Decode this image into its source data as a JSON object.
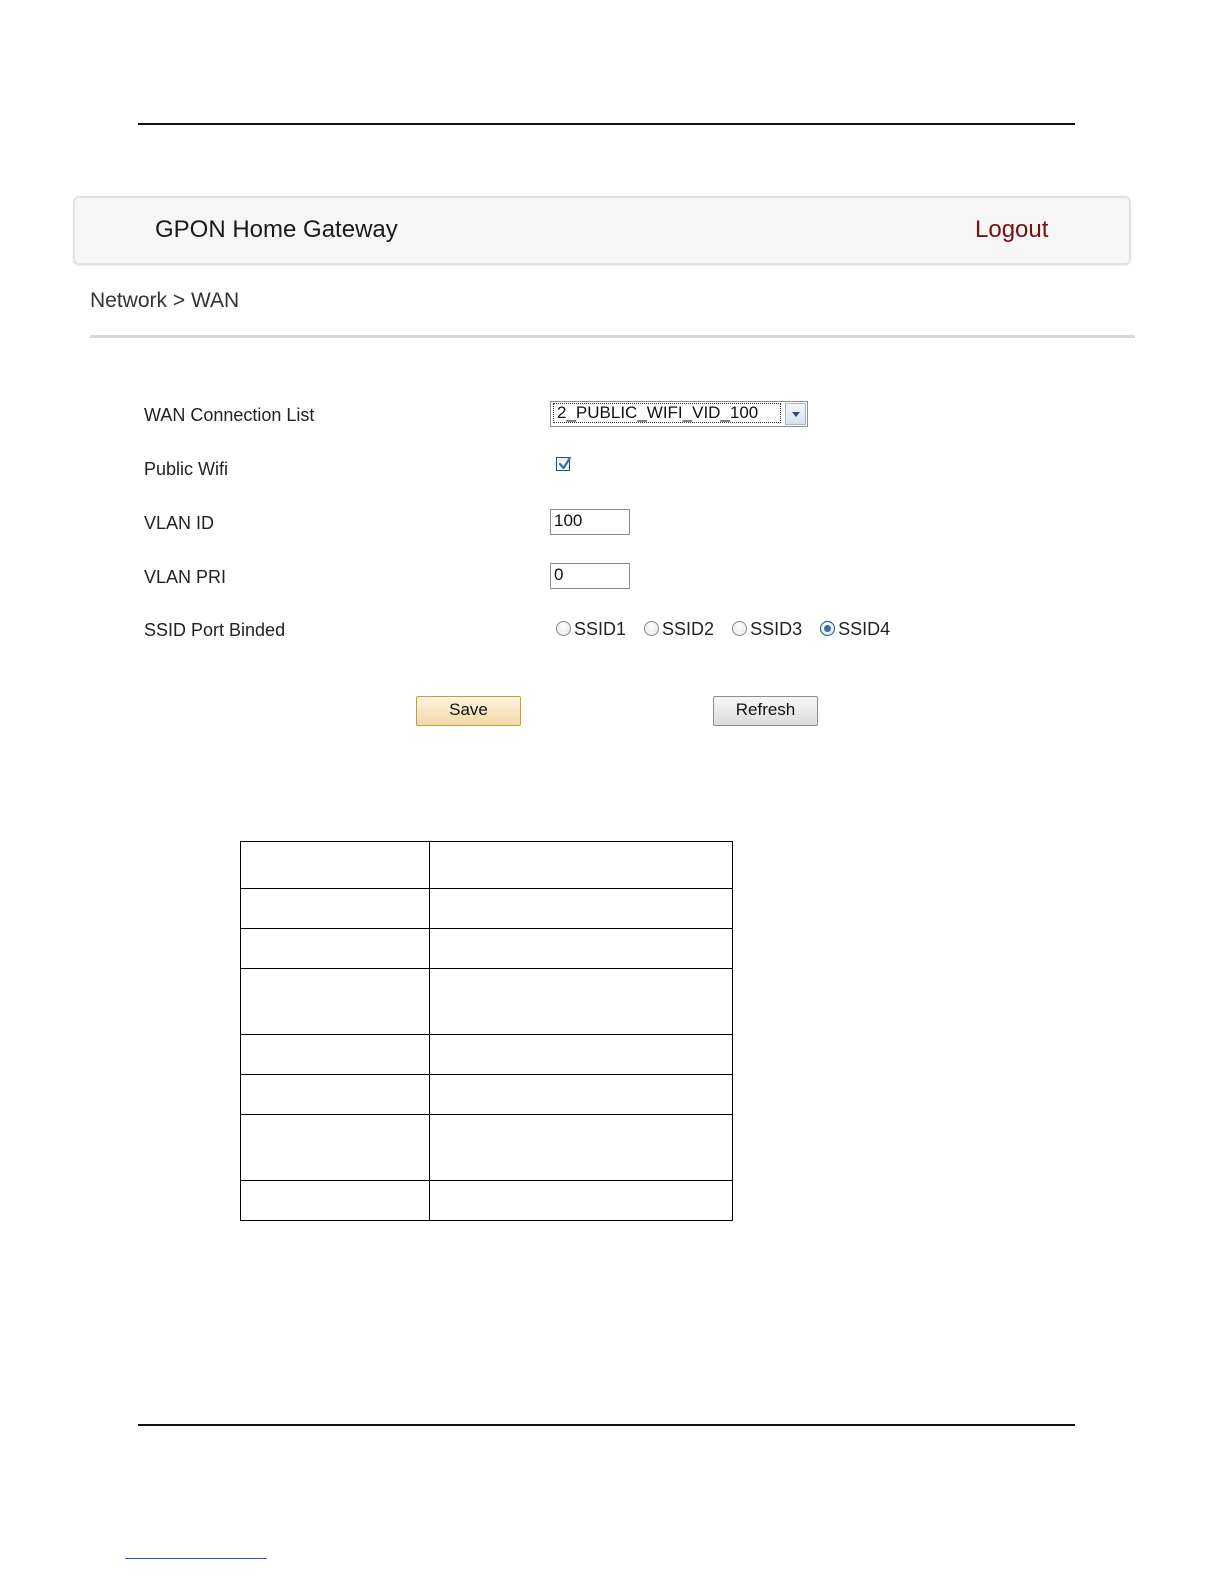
{
  "header": {
    "title": "GPON Home Gateway",
    "logout_label": "Logout"
  },
  "breadcrumb": "Network > WAN",
  "form": {
    "wan_connection": {
      "label": "WAN Connection List",
      "selected": "2_PUBLIC_WIFI_VID_100"
    },
    "public_wifi": {
      "label": "Public Wifi",
      "checked": true
    },
    "vlan_id": {
      "label": "VLAN ID",
      "value": "100"
    },
    "vlan_pri": {
      "label": "VLAN PRI",
      "value": "0"
    },
    "ssid_port": {
      "label": "SSID Port Binded",
      "options": [
        "SSID1",
        "SSID2",
        "SSID3",
        "SSID4"
      ],
      "selected": "SSID4"
    }
  },
  "buttons": {
    "save": "Save",
    "refresh": "Refresh"
  },
  "colors": {
    "logout": "#7a1010",
    "checkbox_accent": "#2f6fb3"
  }
}
